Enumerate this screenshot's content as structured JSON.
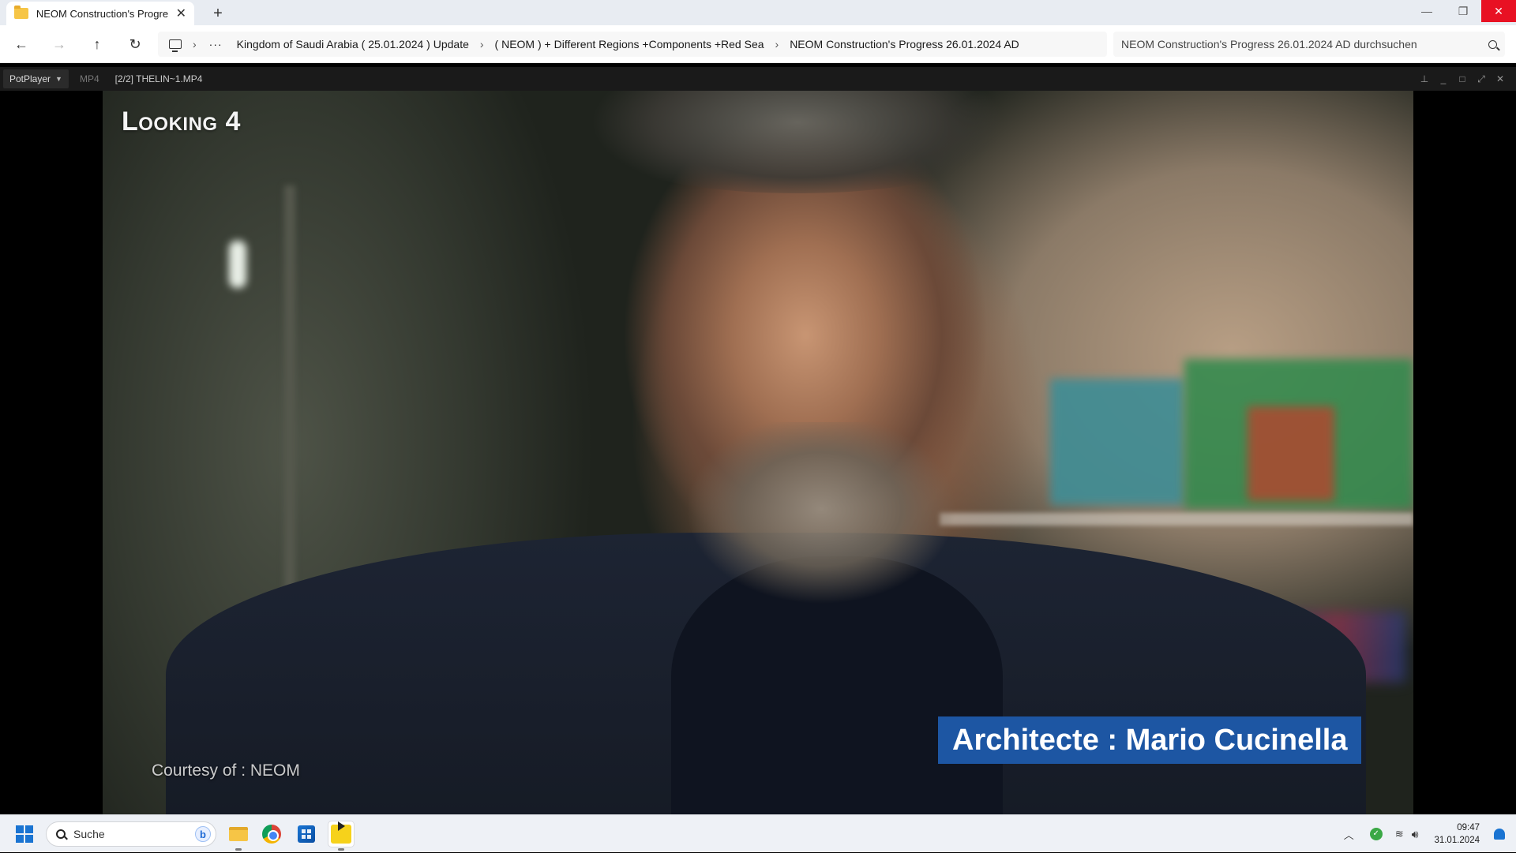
{
  "explorer": {
    "tab_title": "NEOM Construction's Progress",
    "breadcrumb": [
      "Kingdom of Saudi Arabia ( 25.01.2024 ) Update",
      "( NEOM ) + Different Regions +Components +Red Sea",
      "NEOM Construction's Progress 26.01.2024 AD"
    ],
    "search_placeholder": "NEOM Construction's Progress 26.01.2024 AD durchsuchen"
  },
  "player": {
    "menu_label": "PotPlayer",
    "format": "MP4",
    "file_label": "[2/2] THELIN~1.MP4",
    "overlay": {
      "logo_text": "Looking 4",
      "courtesy": "Courtesy of : NEOM",
      "caption": "Architecte : Mario Cucinella"
    }
  },
  "taskbar": {
    "search_label": "Suche",
    "clock_time": "09:47",
    "clock_date": "31.01.2024",
    "apps": [
      "file-explorer",
      "chrome",
      "microsoft-store",
      "potplayer"
    ],
    "accent_color": "#1a74d2",
    "caption_color": "#1d56a3",
    "close_color": "#e81123"
  }
}
